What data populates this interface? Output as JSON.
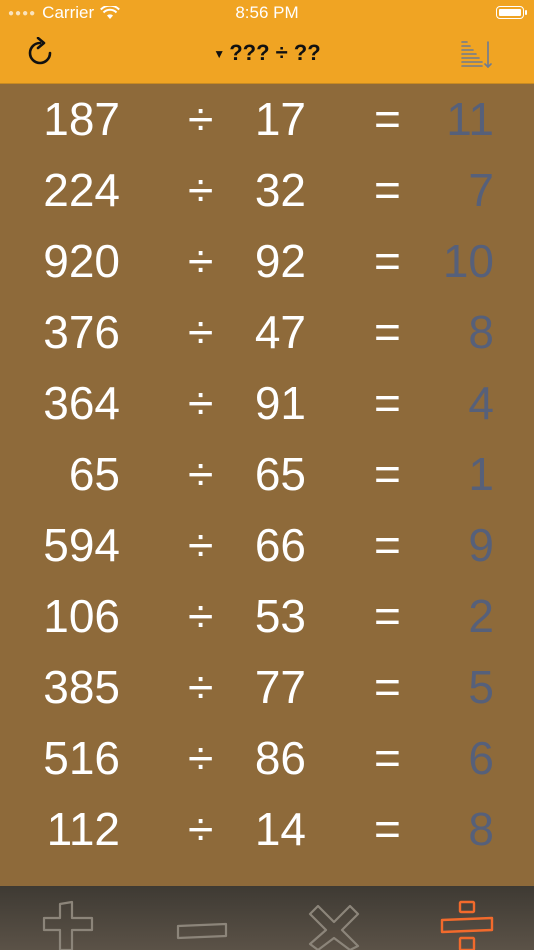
{
  "status": {
    "carrier": "Carrier",
    "time": "8:56 PM"
  },
  "nav": {
    "title": "??? ÷ ??"
  },
  "operator": "÷",
  "equals": "=",
  "rows": [
    {
      "a": "187",
      "b": "17",
      "ans": "11"
    },
    {
      "a": "224",
      "b": "32",
      "ans": "7"
    },
    {
      "a": "920",
      "b": "92",
      "ans": "10"
    },
    {
      "a": "376",
      "b": "47",
      "ans": "8"
    },
    {
      "a": "364",
      "b": "91",
      "ans": "4"
    },
    {
      "a": "65",
      "b": "65",
      "ans": "1"
    },
    {
      "a": "594",
      "b": "66",
      "ans": "9"
    },
    {
      "a": "106",
      "b": "53",
      "ans": "2"
    },
    {
      "a": "385",
      "b": "77",
      "ans": "5"
    },
    {
      "a": "516",
      "b": "86",
      "ans": "6"
    },
    {
      "a": "112",
      "b": "14",
      "ans": "8"
    }
  ],
  "colors": {
    "bar": "#f0a423",
    "background": "#8e6a3a",
    "answer": "#56607a",
    "active_tab": "#f26a2c"
  },
  "tabs": [
    "plus-icon",
    "minus-icon",
    "multiply-icon",
    "divide-icon"
  ]
}
